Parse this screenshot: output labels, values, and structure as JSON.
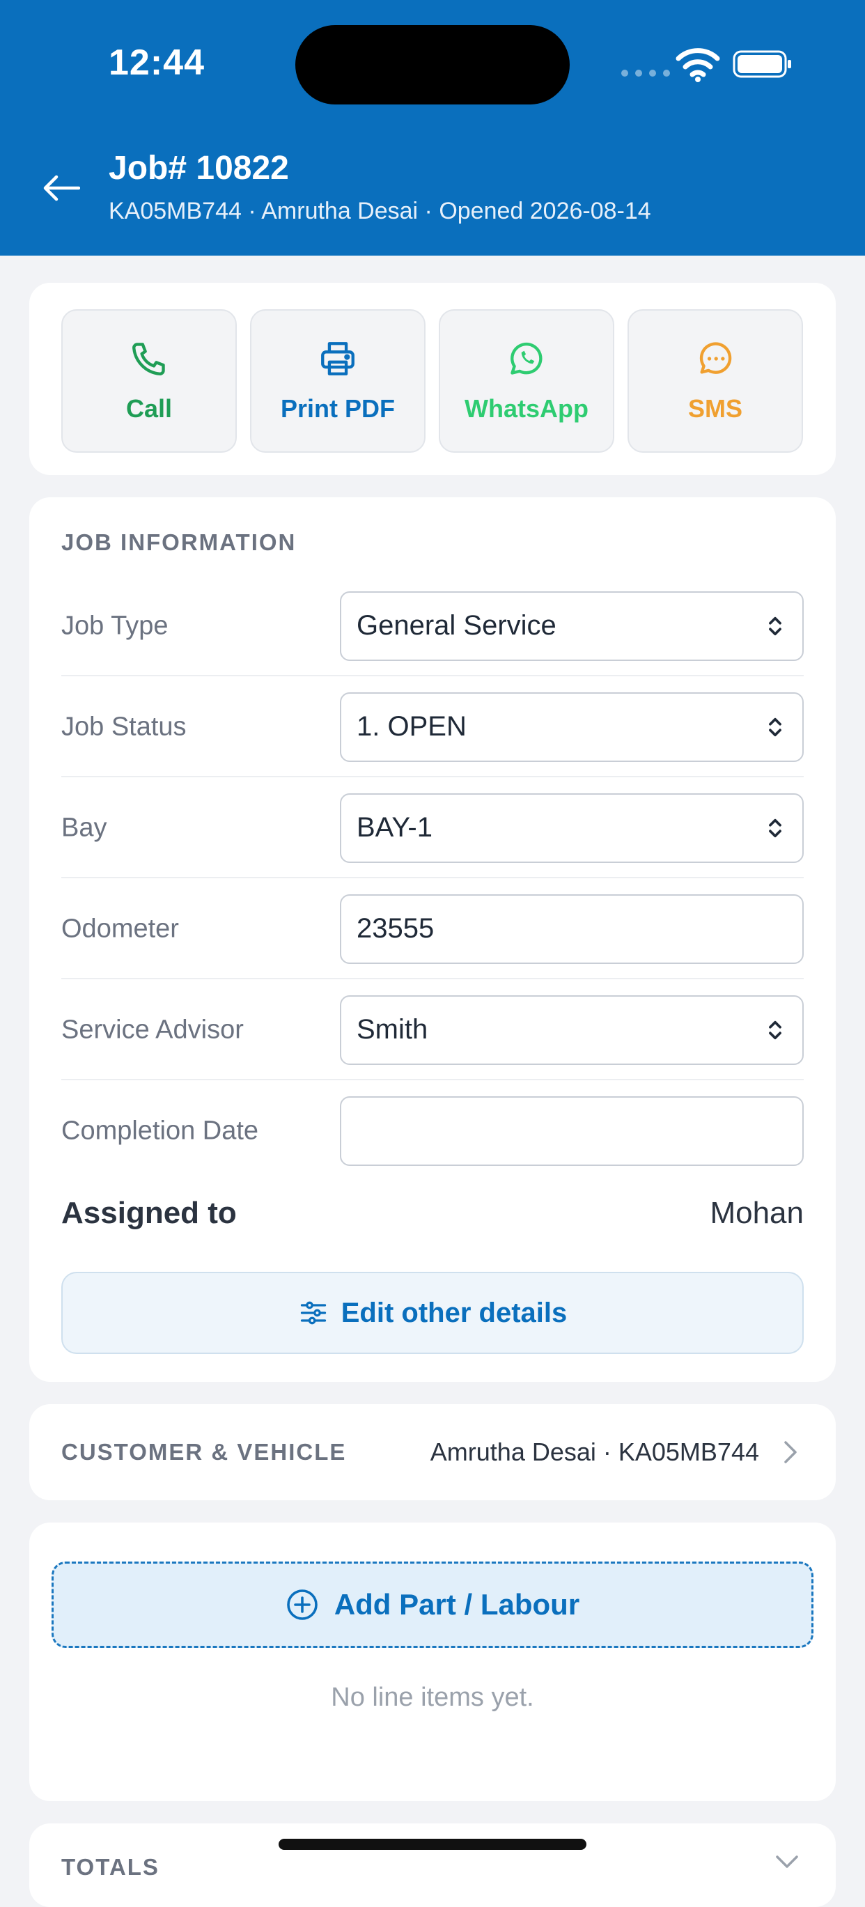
{
  "status_bar": {
    "time": "12:44"
  },
  "header": {
    "title": "Job# 10822",
    "subtitle": "KA05MB744 · Amrutha Desai · Opened 2026-08-14",
    "back_icon": "arrow-left-icon"
  },
  "actions": [
    {
      "label": "Call",
      "icon": "phone-icon",
      "color": "#1f9d55"
    },
    {
      "label": "Print PDF",
      "icon": "printer-icon",
      "color": "#0a6fbd"
    },
    {
      "label": "WhatsApp",
      "icon": "whatsapp-icon",
      "color": "#2ecc71"
    },
    {
      "label": "SMS",
      "icon": "chat-bubble-icon",
      "color": "#f0a030"
    }
  ],
  "job_info": {
    "section_title": "JOB INFORMATION",
    "fields": [
      {
        "label": "Job Type",
        "value": "General Service",
        "type": "select"
      },
      {
        "label": "Job Status",
        "value": "1. OPEN",
        "type": "select"
      },
      {
        "label": "Bay",
        "value": "BAY-1",
        "type": "select"
      },
      {
        "label": "Odometer",
        "value": "23555",
        "type": "input"
      },
      {
        "label": "Service Advisor",
        "value": "Smith",
        "type": "select"
      },
      {
        "label": "Completion Date",
        "value": "",
        "type": "input"
      }
    ],
    "assigned_label": "Assigned to",
    "assigned_value": "Mohan",
    "edit_button": "Edit other details"
  },
  "customer_vehicle": {
    "label": "CUSTOMER & VEHICLE",
    "value": "Amrutha Desai · KA05MB744"
  },
  "line_items": {
    "add_button": "Add Part / Labour",
    "empty_text": "No line items yet."
  },
  "totals": {
    "label": "TOTALS"
  },
  "colors": {
    "brand": "#0a6fbd",
    "background": "#f2f3f6"
  }
}
